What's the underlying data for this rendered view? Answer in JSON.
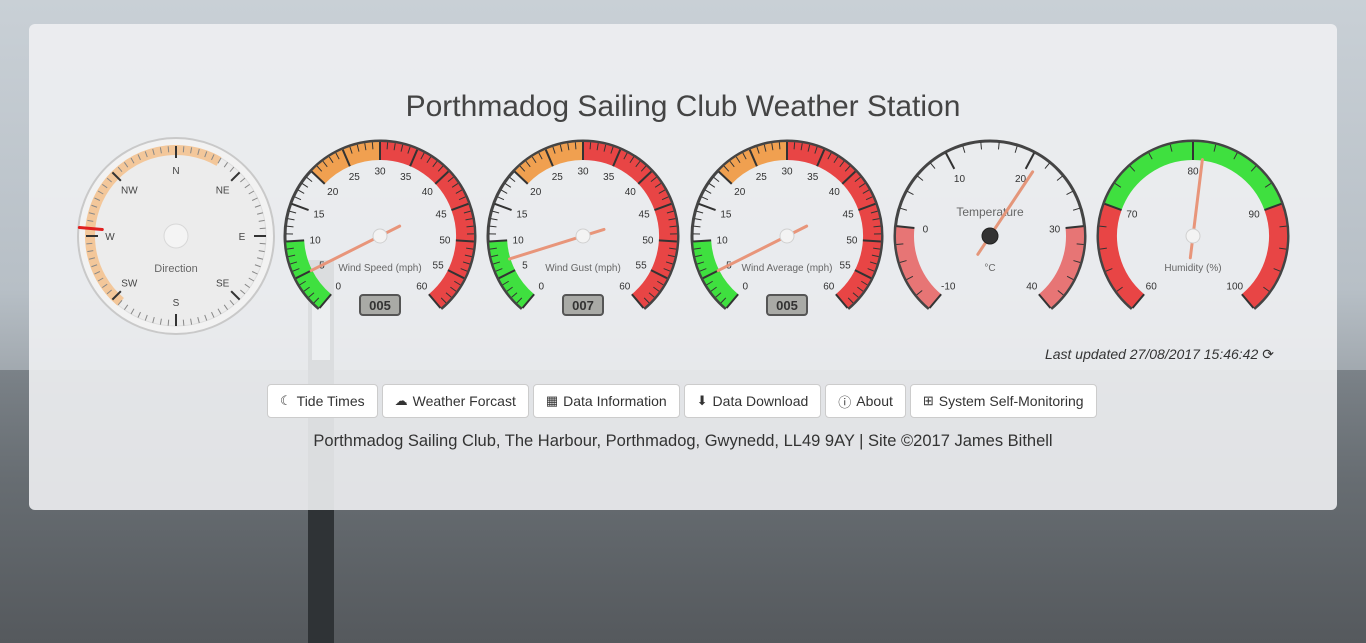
{
  "title": "Porthmadog Sailing Club Weather Station",
  "compass": {
    "label": "Direction",
    "labels": [
      "N",
      "NE",
      "E",
      "SE",
      "S",
      "SW",
      "W",
      "NW"
    ],
    "value_deg": 275
  },
  "gauges": [
    {
      "id": "wind-speed",
      "label": "Wind Speed (mph)",
      "min": 0,
      "max": 60,
      "ticks": [
        0,
        5,
        10,
        15,
        20,
        25,
        30,
        35,
        40,
        45,
        50,
        55,
        60
      ],
      "value": 5,
      "display": "005",
      "zones": [
        {
          "from": 0,
          "to": 10,
          "color": "#3fe03f"
        },
        {
          "from": 20,
          "to": 30,
          "color": "#f0a050"
        },
        {
          "from": 30,
          "to": 60,
          "color": "#e84545"
        }
      ]
    },
    {
      "id": "wind-gust",
      "label": "Wind Gust (mph)",
      "min": 0,
      "max": 60,
      "ticks": [
        0,
        5,
        10,
        15,
        20,
        25,
        30,
        35,
        40,
        45,
        50,
        55,
        60
      ],
      "value": 7,
      "display": "007",
      "zones": [
        {
          "from": 0,
          "to": 10,
          "color": "#3fe03f"
        },
        {
          "from": 20,
          "to": 30,
          "color": "#f0a050"
        },
        {
          "from": 30,
          "to": 60,
          "color": "#e84545"
        }
      ]
    },
    {
      "id": "wind-average",
      "label": "Wind Average (mph)",
      "min": 0,
      "max": 60,
      "ticks": [
        0,
        5,
        10,
        15,
        20,
        25,
        30,
        35,
        40,
        45,
        50,
        55,
        60
      ],
      "value": 5,
      "display": "005",
      "zones": [
        {
          "from": 0,
          "to": 10,
          "color": "#3fe03f"
        },
        {
          "from": 20,
          "to": 30,
          "color": "#f0a050"
        },
        {
          "from": 30,
          "to": 60,
          "color": "#e84545"
        }
      ]
    },
    {
      "id": "temperature",
      "label": "Temperature",
      "unit": "°C",
      "min": -10,
      "max": 40,
      "ticks": [
        -10,
        0,
        10,
        20,
        30,
        40
      ],
      "value": 21,
      "zones": [
        {
          "from": -10,
          "to": 0,
          "color": "#e77575"
        },
        {
          "from": 30,
          "to": 40,
          "color": "#e77575"
        }
      ]
    },
    {
      "id": "humidity",
      "label": "Humidity (%)",
      "min": 60,
      "max": 100,
      "ticks": [
        60,
        70,
        80,
        90,
        100
      ],
      "value": 81,
      "zones": [
        {
          "from": 60,
          "to": 70,
          "color": "#e84545"
        },
        {
          "from": 70,
          "to": 90,
          "color": "#3fe03f"
        },
        {
          "from": 90,
          "to": 100,
          "color": "#e84545"
        }
      ]
    }
  ],
  "last_updated": "Last updated 27/08/2017 15:46:42",
  "nav": [
    {
      "label": "Tide Times",
      "icon": "moon-icon"
    },
    {
      "label": "Weather Forcast",
      "icon": "cloud-icon"
    },
    {
      "label": "Data Information",
      "icon": "table-icon"
    },
    {
      "label": "Data Download",
      "icon": "cloud-download-icon"
    },
    {
      "label": "About",
      "icon": "info-icon"
    },
    {
      "label": "System Self-Monitoring",
      "icon": "medkit-icon"
    }
  ],
  "footer": "Porthmadog Sailing Club, The Harbour, Porthmadog, Gwynedd, LL49 9AY | Site ©2017 James Bithell"
}
